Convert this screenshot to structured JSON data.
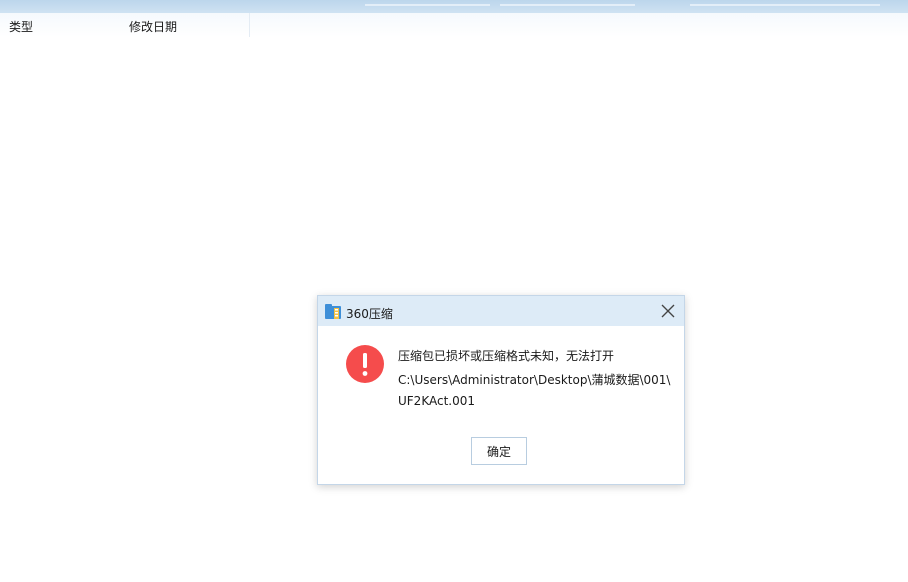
{
  "file_list": {
    "columns": [
      "类型",
      "修改日期"
    ]
  },
  "dialog": {
    "title": "360压缩",
    "app_icon": "360zip-app-icon",
    "message_icon": "error-exclamation-icon",
    "error_color": "#f54c4c",
    "message_lines": [
      "压缩包已损坏或压缩格式未知，无法打开",
      "C:\\Users\\Administrator\\Desktop\\蒲城数据\\001\\",
      "UF2KAct.001"
    ],
    "ok_label": "确定",
    "close_icon": "close-icon"
  }
}
